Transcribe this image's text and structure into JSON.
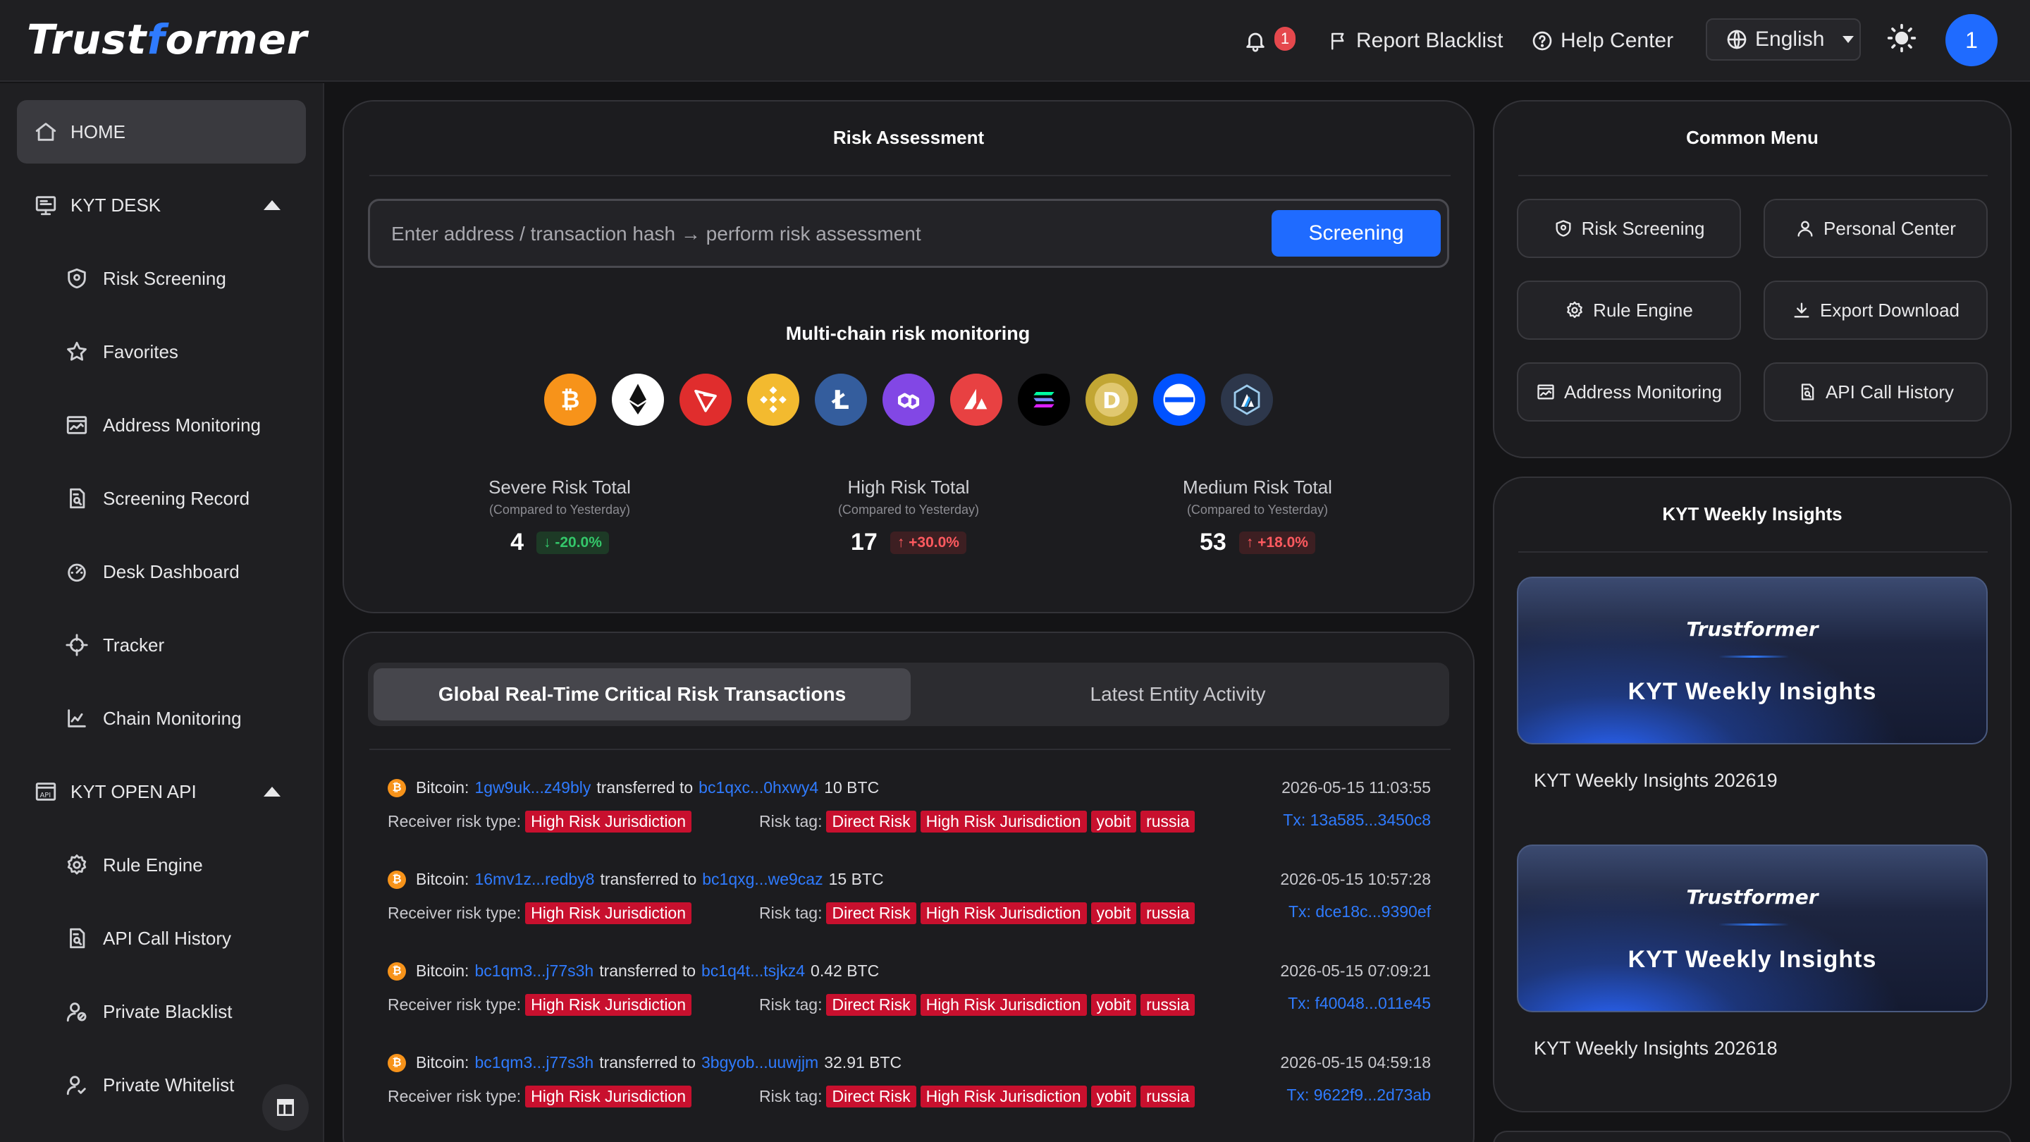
{
  "header": {
    "logo_prefix": "Trust",
    "logo_f": "f",
    "logo_suffix": "ormer",
    "notifications_count": "1",
    "report_blacklist": "Report Blacklist",
    "help_center": "Help Center",
    "language": "English",
    "avatar_label": "1"
  },
  "sidebar": {
    "home": "HOME",
    "kyt_desk": "KYT DESK",
    "desk_items": [
      "Risk Screening",
      "Favorites",
      "Address Monitoring",
      "Screening Record",
      "Desk Dashboard",
      "Tracker",
      "Chain Monitoring"
    ],
    "kyt_open_api": "KYT OPEN API",
    "api_items": [
      "Rule Engine",
      "API Call History",
      "Private Blacklist",
      "Private Whitelist"
    ]
  },
  "risk": {
    "title": "Risk Assessment",
    "placeholder": "Enter address / transaction hash → perform risk assessment",
    "screening_button": "Screening",
    "multichain_title": "Multi-chain risk monitoring",
    "chains": [
      "bitcoin",
      "ethereum",
      "tron",
      "bnb",
      "litecoin",
      "polygon",
      "avalanche",
      "solana",
      "dogecoin",
      "usd-coin",
      "arbitrum"
    ],
    "stats": [
      {
        "label": "Severe Risk Total",
        "compare": "(Compared to Yesterday)",
        "value": "4",
        "change": "↓ -20.0%",
        "direction": "down"
      },
      {
        "label": "High Risk Total",
        "compare": "(Compared to Yesterday)",
        "value": "17",
        "change": "↑ +30.0%",
        "direction": "up"
      },
      {
        "label": "Medium Risk Total",
        "compare": "(Compared to Yesterday)",
        "value": "53",
        "change": "↑ +18.0%",
        "direction": "up"
      }
    ]
  },
  "transactions": {
    "tab_active": "Global Real-Time Critical Risk Transactions",
    "tab_inactive": "Latest Entity Activity",
    "receiver_label": "Receiver risk type:",
    "risk_tag_label": "Risk tag:",
    "transferred_to": "transferred to",
    "items": [
      {
        "chain": "Bitcoin:",
        "from": "1gw9uk...z49bly",
        "to": "bc1qxc...0hxwy4",
        "amount": "10 BTC",
        "receiver_risk": "High Risk Jurisdiction",
        "tags": [
          "Direct Risk",
          "High Risk Jurisdiction",
          "yobit",
          "russia"
        ],
        "time": "2026-05-15 11:03:55",
        "hash": "Tx: 13a585...3450c8"
      },
      {
        "chain": "Bitcoin:",
        "from": "16mv1z...redby8",
        "to": "bc1qxg...we9caz",
        "amount": "15 BTC",
        "receiver_risk": "High Risk Jurisdiction",
        "tags": [
          "Direct Risk",
          "High Risk Jurisdiction",
          "yobit",
          "russia"
        ],
        "time": "2026-05-15 10:57:28",
        "hash": "Tx: dce18c...9390ef"
      },
      {
        "chain": "Bitcoin:",
        "from": "bc1qm3...j77s3h",
        "to": "bc1q4t...tsjkz4",
        "amount": "0.42 BTC",
        "receiver_risk": "High Risk Jurisdiction",
        "tags": [
          "Direct Risk",
          "High Risk Jurisdiction",
          "yobit",
          "russia"
        ],
        "time": "2026-05-15 07:09:21",
        "hash": "Tx: f40048...011e45"
      },
      {
        "chain": "Bitcoin:",
        "from": "bc1qm3...j77s3h",
        "to": "3bgyob...uuwjjm",
        "amount": "32.91 BTC",
        "receiver_risk": "High Risk Jurisdiction",
        "tags": [
          "Direct Risk",
          "High Risk Jurisdiction",
          "yobit",
          "russia"
        ],
        "time": "2026-05-15 04:59:18",
        "hash": "Tx: 9622f9...2d73ab"
      }
    ]
  },
  "common_menu": {
    "title": "Common Menu",
    "items": [
      "Risk Screening",
      "Personal Center",
      "Rule Engine",
      "Export Download",
      "Address Monitoring",
      "API Call History"
    ]
  },
  "weekly": {
    "title": "KYT Weekly Insights",
    "cards": [
      {
        "brand": "Trustformer",
        "heading": "KYT Weekly Insights",
        "caption": "KYT Weekly Insights 202619"
      },
      {
        "brand": "Trustformer",
        "heading": "KYT Weekly Insights",
        "caption": "KYT Weekly Insights 202618"
      }
    ]
  },
  "colors": {
    "accent": "#1f6bff",
    "danger": "#c8102e",
    "success": "#34c76a"
  }
}
